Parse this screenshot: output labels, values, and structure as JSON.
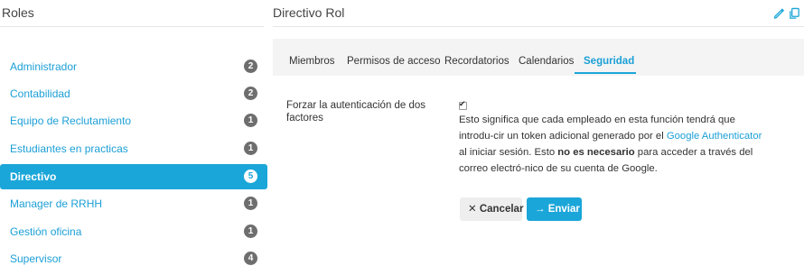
{
  "left_panel": {
    "title": "Roles",
    "roles": [
      {
        "label": "Administrador",
        "count": "2",
        "active": false
      },
      {
        "label": "Contabilidad",
        "count": "2",
        "active": false
      },
      {
        "label": "Equipo de Reclutamiento",
        "count": "1",
        "active": false
      },
      {
        "label": "Estudiantes en practicas",
        "count": "1",
        "active": false
      },
      {
        "label": "Directivo",
        "count": "5",
        "active": true
      },
      {
        "label": "Manager de RRHH",
        "count": "1",
        "active": false
      },
      {
        "label": "Gestión oficina",
        "count": "1",
        "active": false
      },
      {
        "label": "Supervisor",
        "count": "4",
        "active": false
      }
    ]
  },
  "right_panel": {
    "title": "Directivo Rol",
    "icons": [
      "pencil-icon",
      "copy-icon"
    ],
    "tabs": [
      {
        "label": "Miembros",
        "active": false
      },
      {
        "label": "Permisos de acceso",
        "active": false
      },
      {
        "label": "Recordatorios",
        "active": false
      },
      {
        "label": "Calendarios",
        "active": false
      },
      {
        "label": "Seguridad",
        "active": true
      }
    ],
    "security": {
      "field_label": "Forzar la autenticación de dos factores",
      "checked": true,
      "desc_part1": "Esto significa que cada empleado en esta función tendrá que introdu-cir un token adicional generado por el ",
      "desc_link": "Google Authenticator",
      "desc_part2": " al iniciar sesión. Esto ",
      "desc_bold": "no es necesario",
      "desc_part3": " para acceder a través del correo electró-nico de su cuenta de Google."
    },
    "buttons": {
      "cancel": "✕ Cancelar",
      "send": "→ Enviar"
    }
  },
  "colors": {
    "accent": "#1ba6d9",
    "badge": "#6e6e6e",
    "tab_bg": "#f4f4f4"
  }
}
